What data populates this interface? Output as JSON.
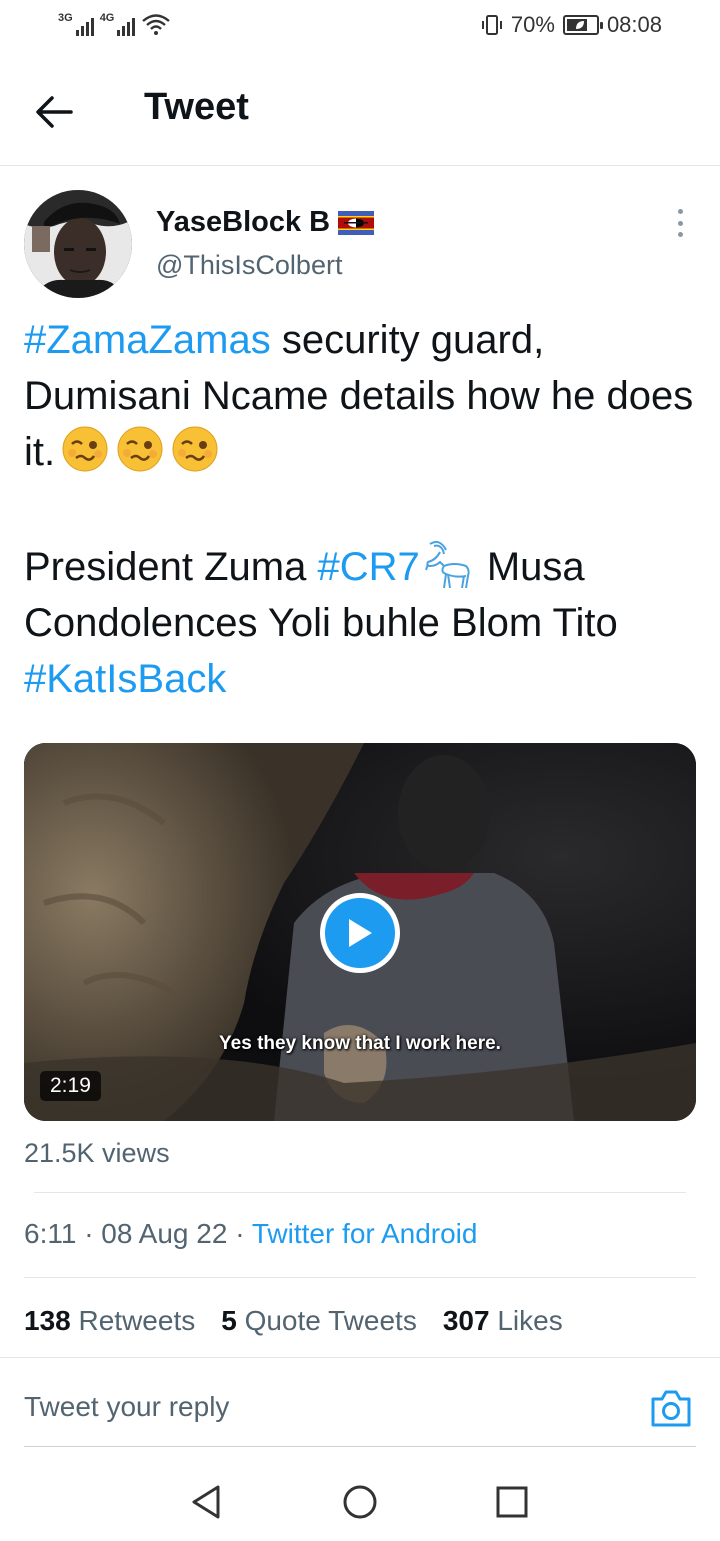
{
  "status_bar": {
    "sim1": "3G",
    "sim2": "4G",
    "battery": "70%",
    "battery_level": 0.7,
    "time": "08:08"
  },
  "header": {
    "title": "Tweet"
  },
  "author": {
    "name": "YaseBlock B",
    "handle": "@ThisIsColbert"
  },
  "tweet": {
    "line1": {
      "hashtag": "#ZamaZamas",
      "text": " security guard, Dumisani Ncame details how he does it."
    },
    "line2": {
      "text_before": "President Zuma ",
      "hashtag": "#CR7",
      "text_after": " Musa Condolences Yoli buhle Blom Tito ",
      "hashtag2": "#KatIsBack"
    }
  },
  "video": {
    "subtitle": "Yes they know that I work here.",
    "duration": "2:19"
  },
  "views": "21.5K views",
  "meta": {
    "timestamp": "6:11 · 08 Aug 22 · ",
    "source": "Twitter for Android"
  },
  "stats": {
    "retweets_count": "138",
    "retweets_label": "Retweets",
    "quotes_count": "5",
    "quotes_label": "Quote Tweets",
    "likes_count": "307",
    "likes_label": "Likes"
  },
  "reply": {
    "placeholder": "Tweet your reply"
  },
  "colors": {
    "accent": "#1d9bf0",
    "text": "#0f1419",
    "secondary": "#536471"
  }
}
